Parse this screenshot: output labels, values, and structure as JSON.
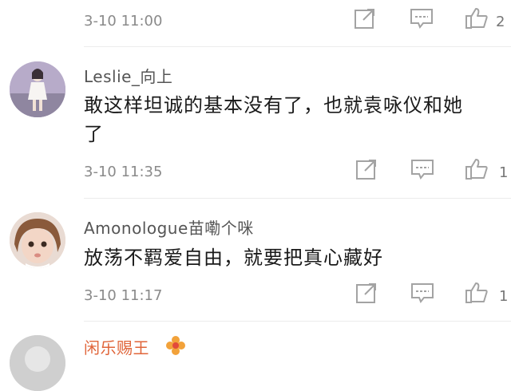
{
  "colors": {
    "icon": "#a3a3a3",
    "text": "#1a1a1a",
    "username": "#555555",
    "meta": "#8a8a8a",
    "username_highlight": "#e0653a"
  },
  "top_item": {
    "time": "3-10 11:00",
    "like_count": "2"
  },
  "comments": [
    {
      "username": "Leslie_向上",
      "text_line1": "敢这样坦诚的基本没有了，也就袁咏仪和她",
      "text_line2": "了",
      "time": "3-10 11:35",
      "like_count": "1"
    },
    {
      "username": "Amonologue苗嘞个咪",
      "text_line1": "放荡不羁爱自由，就要把真心藏好",
      "time": "3-10 11:17",
      "like_count": "1"
    },
    {
      "username": "闲乐赐王"
    }
  ],
  "icons": {
    "share": "share-icon",
    "reply": "comment-icon",
    "like": "thumbs-up-icon"
  }
}
